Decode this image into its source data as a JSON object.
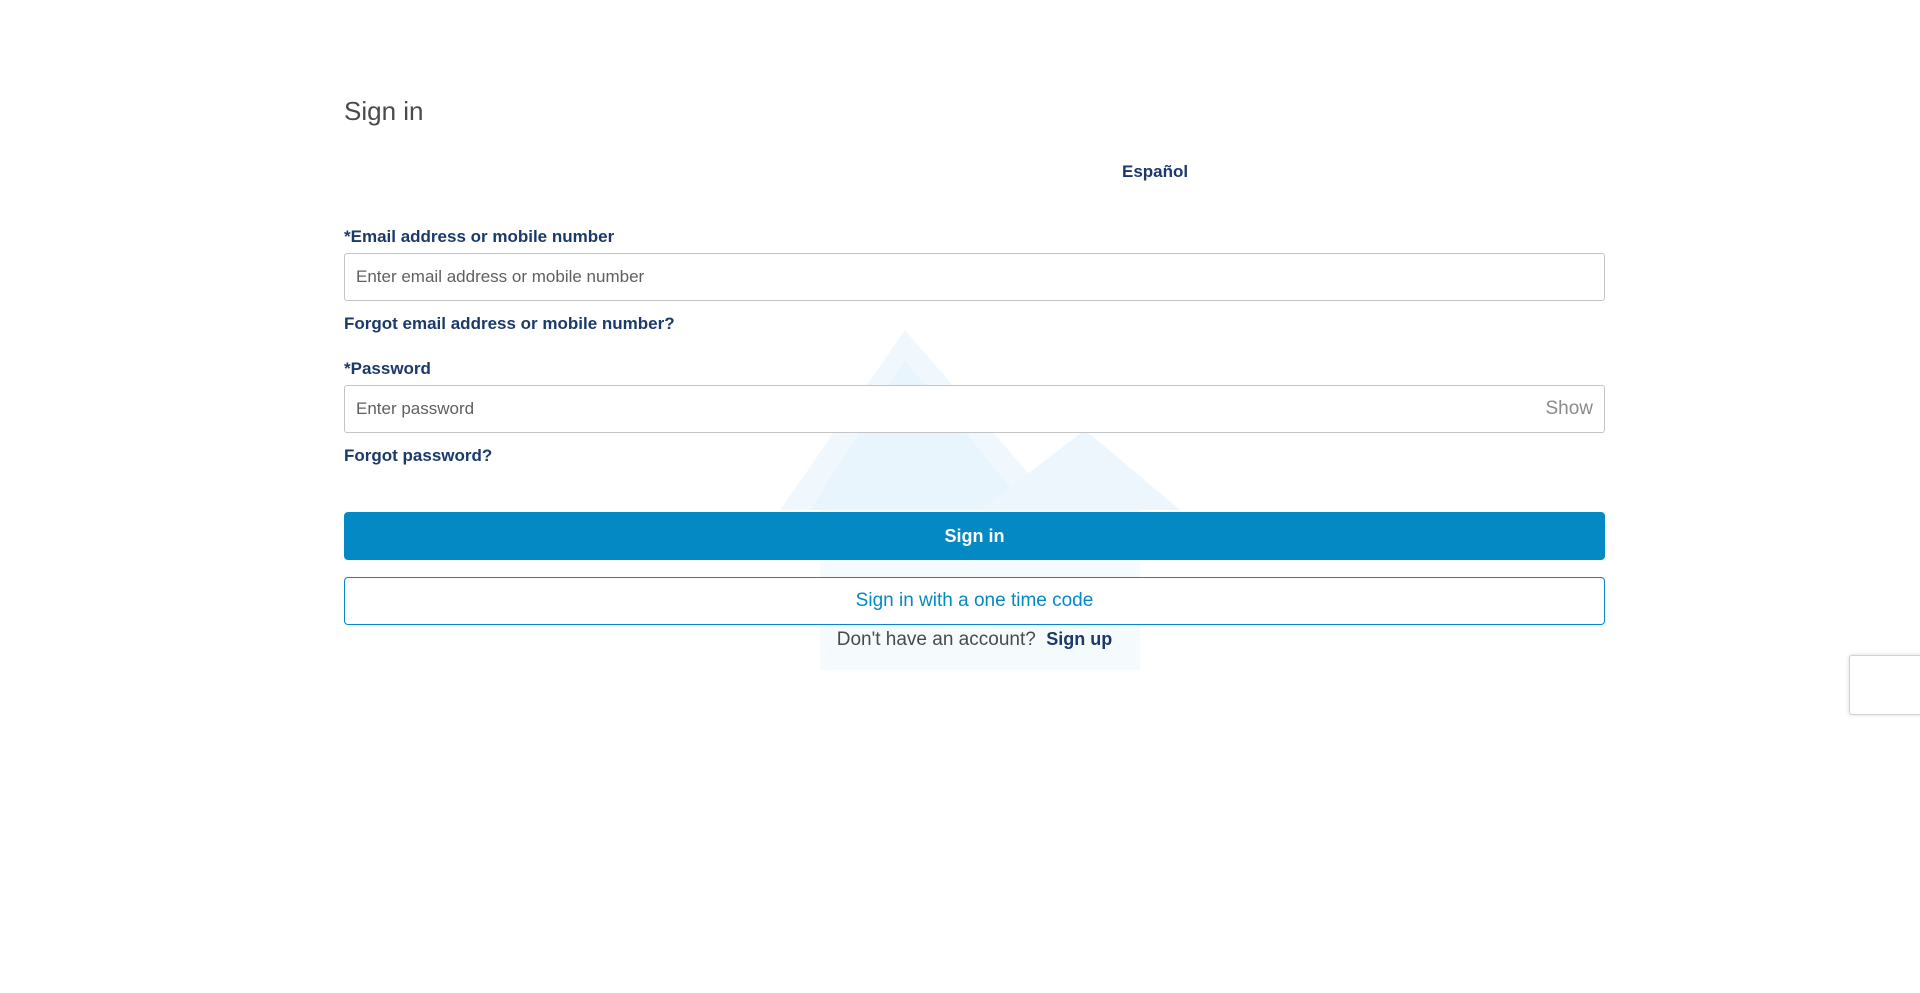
{
  "page": {
    "title": "Sign in",
    "language_link": "Español"
  },
  "email": {
    "label": "*Email address or mobile number",
    "placeholder": "Enter email address or mobile number",
    "value": "",
    "forgot_link": "Forgot email address or mobile number?"
  },
  "password": {
    "label": "*Password",
    "placeholder": "Enter password",
    "value": "",
    "show_toggle": "Show",
    "forgot_link": "Forgot password?"
  },
  "actions": {
    "sign_in_button": "Sign in",
    "one_time_code_button": "Sign in with a one time code"
  },
  "signup": {
    "prompt": "Don't have an account?",
    "link": "Sign up"
  },
  "colors": {
    "primary": "#0589c4",
    "link": "#1b3a6b",
    "heading": "#4a4a4a",
    "input_border": "#c4c4c4",
    "watermark": "#e8f4fb"
  },
  "icons": {
    "watermark": "mountain-logo-icon",
    "recaptcha": "recaptcha-badge"
  }
}
